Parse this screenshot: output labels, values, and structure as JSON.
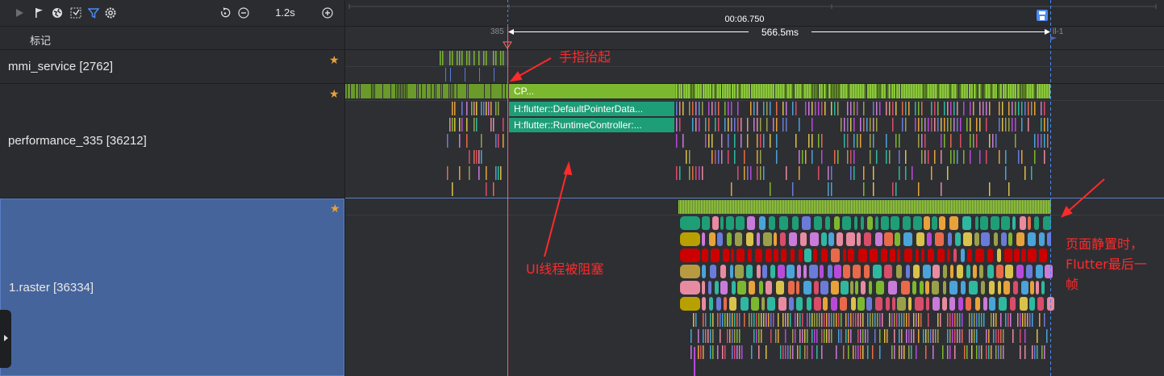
{
  "toolbar": {
    "icons": [
      "play-icon",
      "flag-icon",
      "globe-icon",
      "select-icon",
      "filter-icon",
      "settings-icon",
      "reset-icon",
      "zoom-out-icon",
      "zoom-in-icon"
    ],
    "zoom_label": "1.2s"
  },
  "marker_row": {
    "label": "标记"
  },
  "lanes": [
    {
      "name": "mmi_service [2762]",
      "starred": true
    },
    {
      "name": "performance_335 [36212]",
      "starred": true
    },
    {
      "name": "1.raster [36334]",
      "starred": true,
      "selected": true
    }
  ],
  "timeline": {
    "time_label": "00:06.750",
    "duration_label": "566.5ms",
    "flag_left_label": "385",
    "flag_right_label": "ll-1"
  },
  "slices": [
    {
      "label": "CP..."
    },
    {
      "label": "H:flutter::DefaultPointerData..."
    },
    {
      "label": "H:flutter::RuntimeController:..."
    }
  ],
  "annotations": {
    "finger_up": "手指抬起",
    "ui_blocked": "UI线程被阻塞",
    "page_static": [
      "页面静置时，",
      "Flutter最后一",
      "帧"
    ]
  },
  "colors": {
    "accent": "#4a8af4",
    "selected_lane": "#45649c",
    "annotation": "#ff2a2a",
    "cpu_green": "#7cb82f",
    "slice_teal": "#1e9e77",
    "star": "#e8a23a"
  }
}
